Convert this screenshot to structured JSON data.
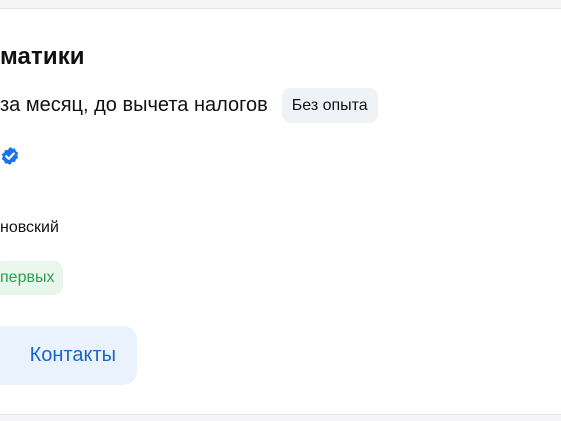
{
  "vacancy": {
    "title": "матики",
    "salary_text": "за месяц, до вычета налогов",
    "experience_tag": "Без опыта",
    "verified_icon": "verified-check-icon",
    "address": "новский",
    "badge": "первых",
    "contacts_label": "Контакты"
  },
  "colors": {
    "accent": "#1867c8",
    "verified": "#1a73e8",
    "badge_text": "#2f9e55",
    "badge_bg": "#e8f6ec",
    "button_bg": "#eaf2fd"
  }
}
